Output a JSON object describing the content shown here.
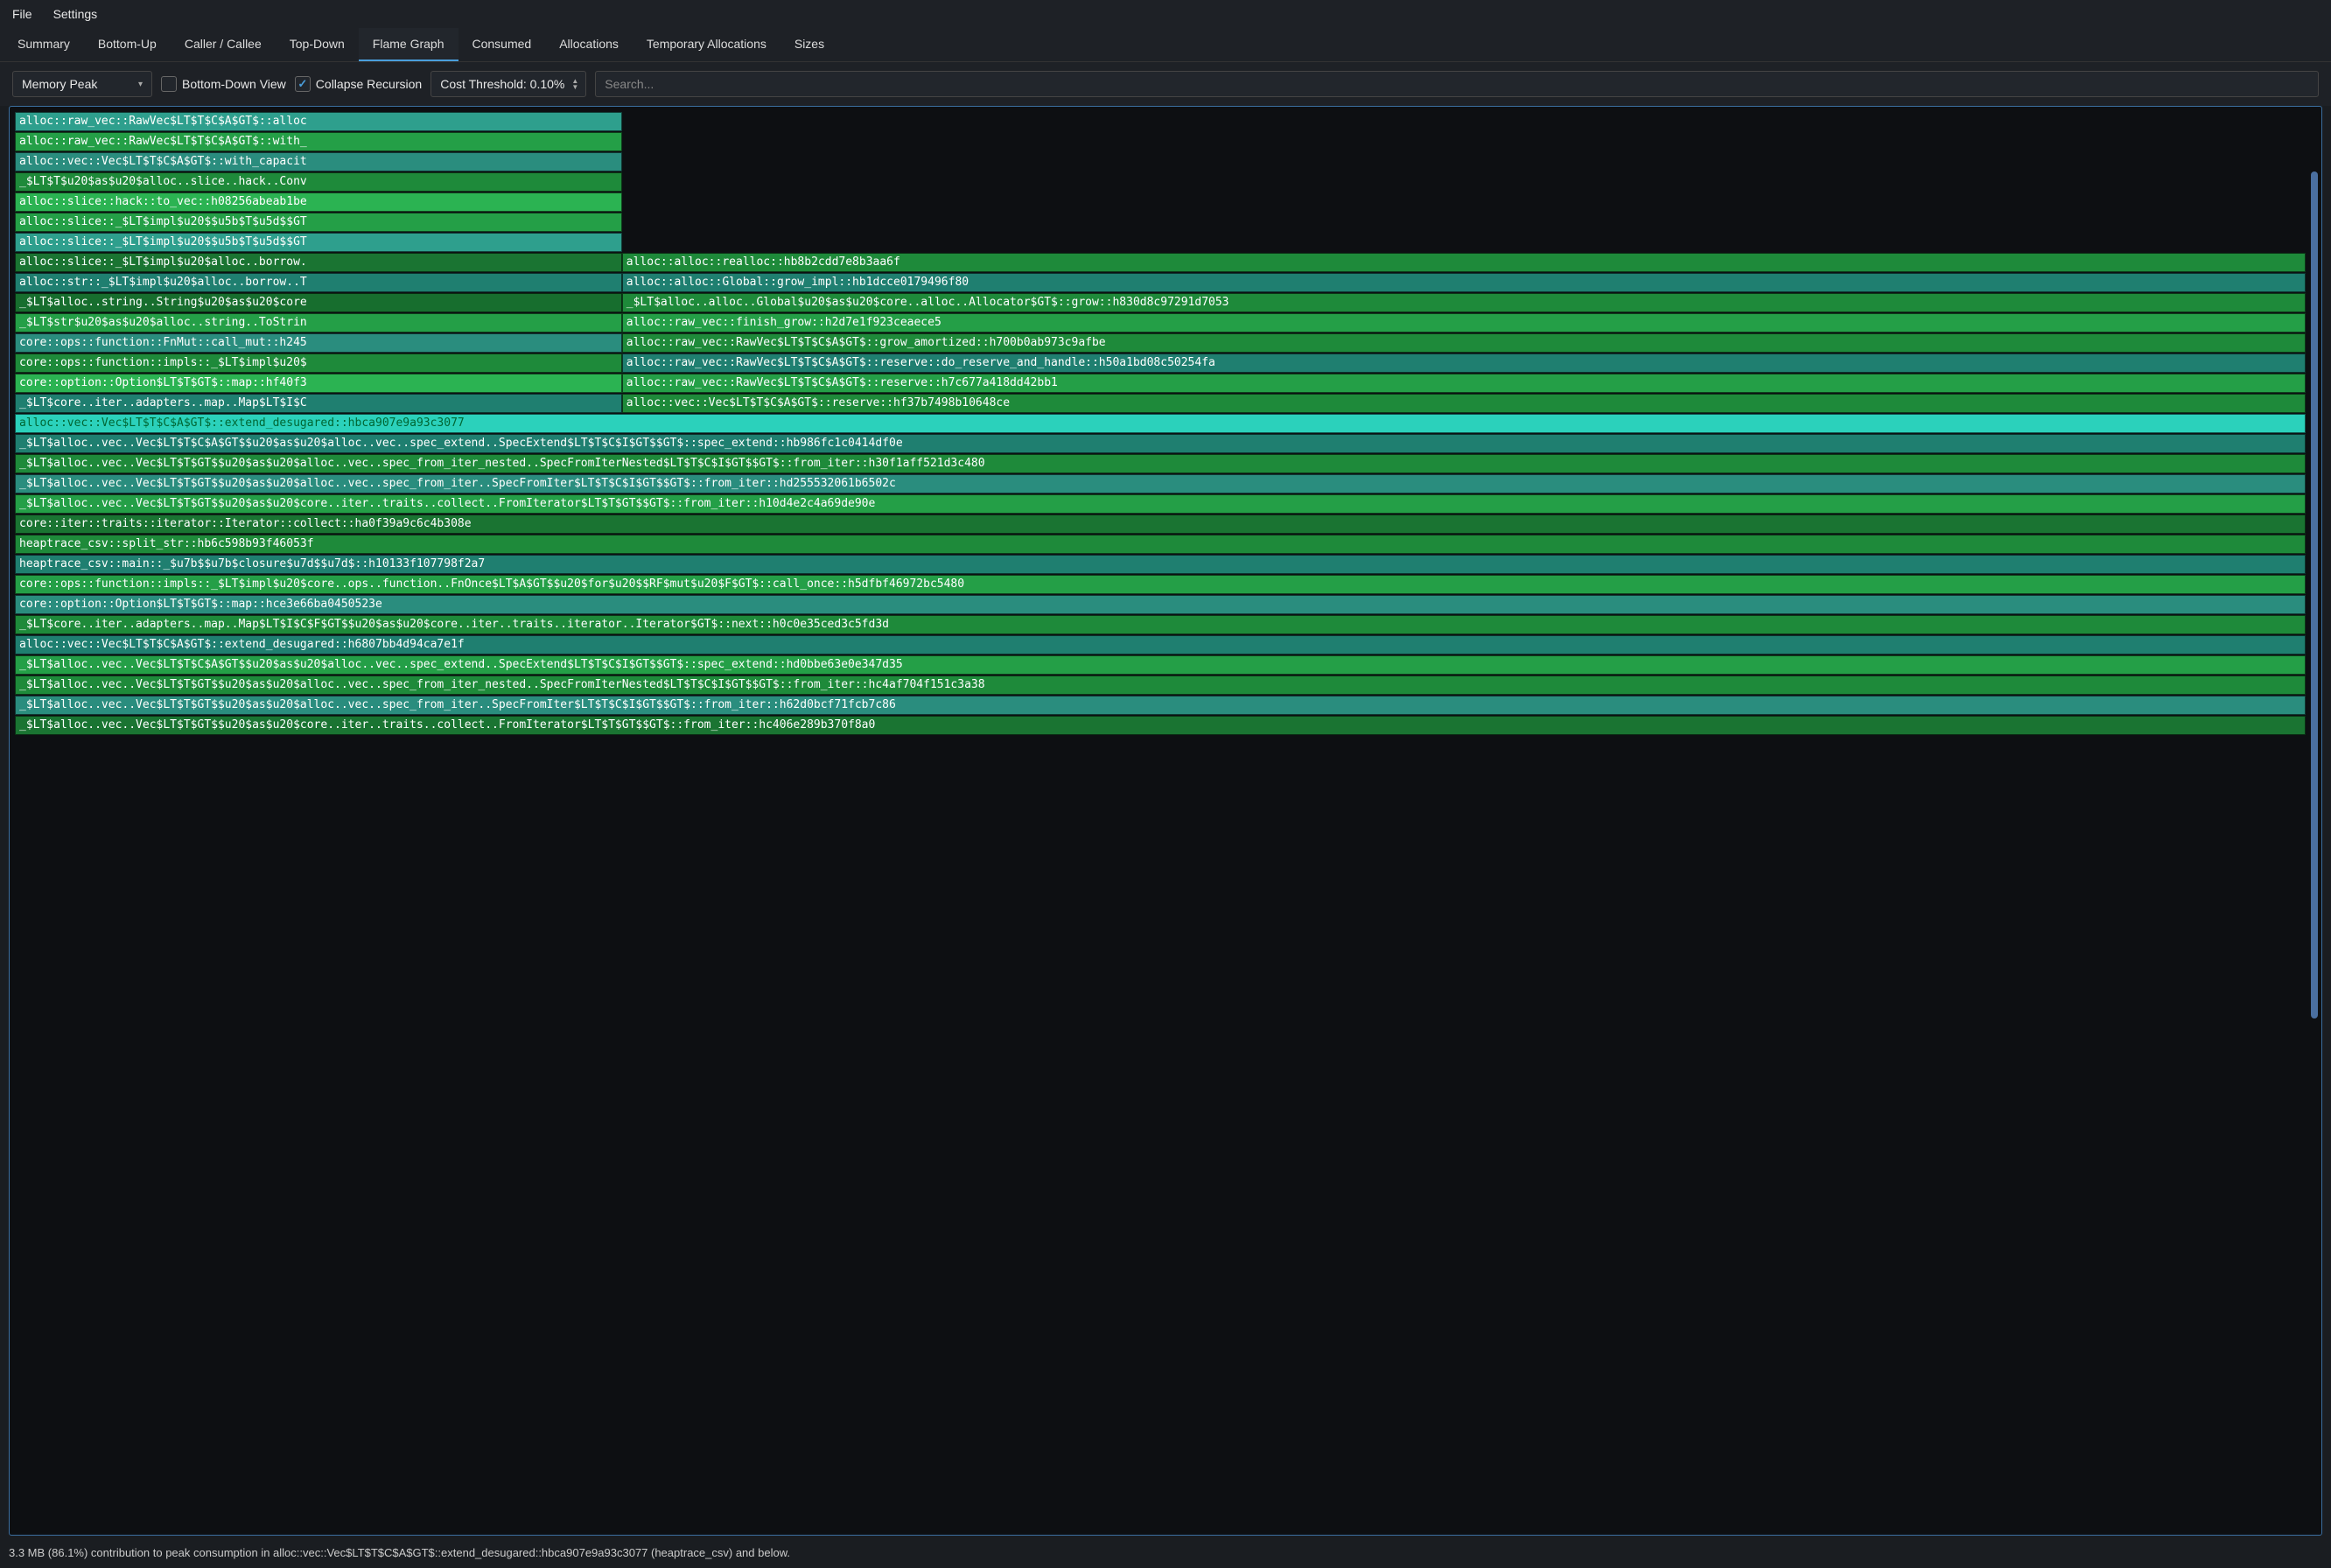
{
  "menu": {
    "file": "File",
    "settings": "Settings"
  },
  "tabs": [
    {
      "label": "Summary"
    },
    {
      "label": "Bottom-Up"
    },
    {
      "label": "Caller / Callee"
    },
    {
      "label": "Top-Down"
    },
    {
      "label": "Flame Graph",
      "active": true
    },
    {
      "label": "Consumed"
    },
    {
      "label": "Allocations"
    },
    {
      "label": "Temporary Allocations"
    },
    {
      "label": "Sizes"
    }
  ],
  "toolbar": {
    "view_selector": "Memory Peak",
    "bottom_down_label": "Bottom-Down View",
    "bottom_down_checked": false,
    "collapse_label": "Collapse Recursion",
    "collapse_checked": true,
    "cost_threshold_label": "Cost Threshold: 0.10%",
    "search_placeholder": "Search..."
  },
  "flame_rows": [
    [
      {
        "left": 0,
        "width": 26.5,
        "cls": "c-teal1",
        "label": "alloc::raw_vec::RawVec$LT$T$C$A$GT$::alloc"
      }
    ],
    [
      {
        "left": 0,
        "width": 26.5,
        "cls": "c-green2",
        "label": "alloc::raw_vec::RawVec$LT$T$C$A$GT$::with_"
      }
    ],
    [
      {
        "left": 0,
        "width": 26.5,
        "cls": "c-teal3",
        "label": "alloc::vec::Vec$LT$T$C$A$GT$::with_capacit"
      }
    ],
    [
      {
        "left": 0,
        "width": 26.5,
        "cls": "c-green1",
        "label": "_$LT$T$u20$as$u20$alloc..slice..hack..Conv"
      }
    ],
    [
      {
        "left": 0,
        "width": 26.5,
        "cls": "c-green3",
        "label": "alloc::slice::hack::to_vec::h08256abeab1be"
      }
    ],
    [
      {
        "left": 0,
        "width": 26.5,
        "cls": "c-green2",
        "label": "alloc::slice::_$LT$impl$u20$$u5b$T$u5d$$GT"
      }
    ],
    [
      {
        "left": 0,
        "width": 26.5,
        "cls": "c-teal1",
        "label": "alloc::slice::_$LT$impl$u20$$u5b$T$u5d$$GT"
      }
    ],
    [
      {
        "left": 0,
        "width": 26.5,
        "cls": "c-green4",
        "label": "alloc::slice::_$LT$impl$u20$alloc..borrow."
      },
      {
        "left": 26.5,
        "width": 73.5,
        "cls": "c-green1",
        "label": "alloc::alloc::realloc::hb8b2cdd7e8b3aa6f"
      }
    ],
    [
      {
        "left": 0,
        "width": 26.5,
        "cls": "c-teal2",
        "label": "alloc::str::_$LT$impl$u20$alloc..borrow..T"
      },
      {
        "left": 26.5,
        "width": 73.5,
        "cls": "c-teal2",
        "label": "alloc::alloc::Global::grow_impl::hb1dcce0179496f80"
      }
    ],
    [
      {
        "left": 0,
        "width": 26.5,
        "cls": "c-darkgreen",
        "label": "_$LT$alloc..string..String$u20$as$u20$core"
      },
      {
        "left": 26.5,
        "width": 73.5,
        "cls": "c-green1",
        "label": "_$LT$alloc..alloc..Global$u20$as$u20$core..alloc..Allocator$GT$::grow::h830d8c97291d7053"
      }
    ],
    [
      {
        "left": 0,
        "width": 26.5,
        "cls": "c-green2",
        "label": "_$LT$str$u20$as$u20$alloc..string..ToStrin"
      },
      {
        "left": 26.5,
        "width": 73.5,
        "cls": "c-green2",
        "label": "alloc::raw_vec::finish_grow::h2d7e1f923ceaece5"
      }
    ],
    [
      {
        "left": 0,
        "width": 26.5,
        "cls": "c-teal3",
        "label": "core::ops::function::FnMut::call_mut::h245"
      },
      {
        "left": 26.5,
        "width": 73.5,
        "cls": "c-green1",
        "label": "alloc::raw_vec::RawVec$LT$T$C$A$GT$::grow_amortized::h700b0ab973c9afbe"
      }
    ],
    [
      {
        "left": 0,
        "width": 26.5,
        "cls": "c-green1",
        "label": "core::ops::function::impls::_$LT$impl$u20$"
      },
      {
        "left": 26.5,
        "width": 73.5,
        "cls": "c-teal2",
        "label": "alloc::raw_vec::RawVec$LT$T$C$A$GT$::reserve::do_reserve_and_handle::h50a1bd08c50254fa"
      }
    ],
    [
      {
        "left": 0,
        "width": 26.5,
        "cls": "c-green3",
        "label": "core::option::Option$LT$T$GT$::map::hf40f3"
      },
      {
        "left": 26.5,
        "width": 73.5,
        "cls": "c-green2",
        "label": "alloc::raw_vec::RawVec$LT$T$C$A$GT$::reserve::h7c677a418dd42bb1"
      }
    ],
    [
      {
        "left": 0,
        "width": 26.5,
        "cls": "c-teal2",
        "label": "_$LT$core..iter..adapters..map..Map$LT$I$C"
      },
      {
        "left": 26.5,
        "width": 73.5,
        "cls": "c-green1",
        "label": "alloc::vec::Vec$LT$T$C$A$GT$::reserve::hf37b7498b10648ce"
      }
    ],
    [
      {
        "left": 0,
        "width": 100,
        "cls": "c-cyan",
        "label": "alloc::vec::Vec$LT$T$C$A$GT$::extend_desugared::hbca907e9a93c3077"
      }
    ],
    [
      {
        "left": 0,
        "width": 100,
        "cls": "c-teal2",
        "label": "_$LT$alloc..vec..Vec$LT$T$C$A$GT$$u20$as$u20$alloc..vec..spec_extend..SpecExtend$LT$T$C$I$GT$$GT$::spec_extend::hb986fc1c0414df0e"
      }
    ],
    [
      {
        "left": 0,
        "width": 100,
        "cls": "c-green1",
        "label": "_$LT$alloc..vec..Vec$LT$T$GT$$u20$as$u20$alloc..vec..spec_from_iter_nested..SpecFromIterNested$LT$T$C$I$GT$$GT$::from_iter::h30f1aff521d3c480"
      }
    ],
    [
      {
        "left": 0,
        "width": 100,
        "cls": "c-teal3",
        "label": "_$LT$alloc..vec..Vec$LT$T$GT$$u20$as$u20$alloc..vec..spec_from_iter..SpecFromIter$LT$T$C$I$GT$$GT$::from_iter::hd255532061b6502c"
      }
    ],
    [
      {
        "left": 0,
        "width": 100,
        "cls": "c-green2",
        "label": "_$LT$alloc..vec..Vec$LT$T$GT$$u20$as$u20$core..iter..traits..collect..FromIterator$LT$T$GT$$GT$::from_iter::h10d4e2c4a69de90e"
      }
    ],
    [
      {
        "left": 0,
        "width": 100,
        "cls": "c-green4",
        "label": "core::iter::traits::iterator::Iterator::collect::ha0f39a9c6c4b308e"
      }
    ],
    [
      {
        "left": 0,
        "width": 100,
        "cls": "c-green1",
        "label": "heaptrace_csv::split_str::hb6c598b93f46053f"
      }
    ],
    [
      {
        "left": 0,
        "width": 100,
        "cls": "c-teal2",
        "label": "heaptrace_csv::main::_$u7b$$u7b$closure$u7d$$u7d$::h10133f107798f2a7"
      }
    ],
    [
      {
        "left": 0,
        "width": 100,
        "cls": "c-green2",
        "label": "core::ops::function::impls::_$LT$impl$u20$core..ops..function..FnOnce$LT$A$GT$$u20$for$u20$$RF$mut$u20$F$GT$::call_once::h5dfbf46972bc5480"
      }
    ],
    [
      {
        "left": 0,
        "width": 100,
        "cls": "c-teal3",
        "label": "core::option::Option$LT$T$GT$::map::hce3e66ba0450523e"
      }
    ],
    [
      {
        "left": 0,
        "width": 100,
        "cls": "c-green1",
        "label": "_$LT$core..iter..adapters..map..Map$LT$I$C$F$GT$$u20$as$u20$core..iter..traits..iterator..Iterator$GT$::next::h0c0e35ced3c5fd3d"
      }
    ],
    [
      {
        "left": 0,
        "width": 100,
        "cls": "c-teal2",
        "label": "alloc::vec::Vec$LT$T$C$A$GT$::extend_desugared::h6807bb4d94ca7e1f"
      }
    ],
    [
      {
        "left": 0,
        "width": 100,
        "cls": "c-green2",
        "label": "_$LT$alloc..vec..Vec$LT$T$C$A$GT$$u20$as$u20$alloc..vec..spec_extend..SpecExtend$LT$T$C$I$GT$$GT$::spec_extend::hd0bbe63e0e347d35"
      }
    ],
    [
      {
        "left": 0,
        "width": 100,
        "cls": "c-green1",
        "label": "_$LT$alloc..vec..Vec$LT$T$GT$$u20$as$u20$alloc..vec..spec_from_iter_nested..SpecFromIterNested$LT$T$C$I$GT$$GT$::from_iter::hc4af704f151c3a38"
      }
    ],
    [
      {
        "left": 0,
        "width": 100,
        "cls": "c-teal3",
        "label": "_$LT$alloc..vec..Vec$LT$T$GT$$u20$as$u20$alloc..vec..spec_from_iter..SpecFromIter$LT$T$C$I$GT$$GT$::from_iter::h62d0bcf71fcb7c86"
      }
    ],
    [
      {
        "left": 0,
        "width": 100,
        "cls": "c-green4",
        "label": "_$LT$alloc..vec..Vec$LT$T$GT$$u20$as$u20$core..iter..traits..collect..FromIterator$LT$T$GT$$GT$::from_iter::hc406e289b370f8a0"
      }
    ]
  ],
  "statusbar": "3.3 MB (86.1%) contribution to peak consumption in alloc::vec::Vec$LT$T$C$A$GT$::extend_desugared::hbca907e9a93c3077 (heaptrace_csv) and below."
}
